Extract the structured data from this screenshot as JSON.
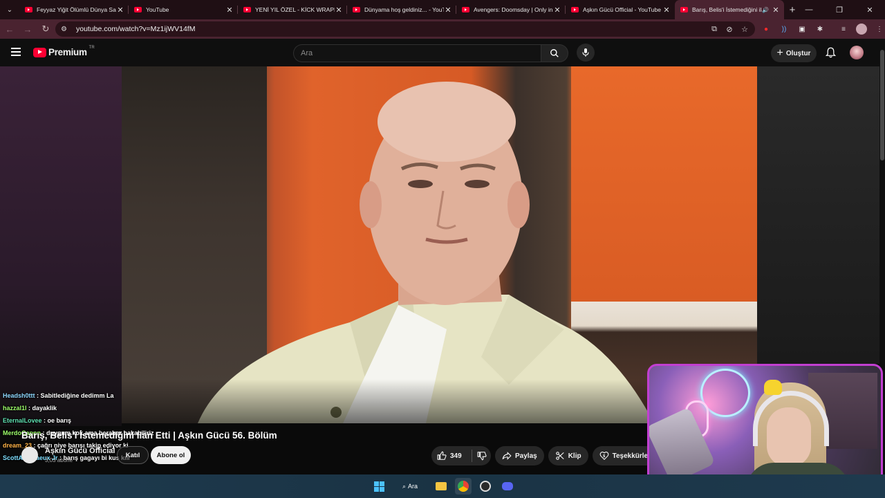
{
  "browser": {
    "tabs": [
      {
        "title": "Feyyaz Yiğit Ölümlü Dünya Sah",
        "active": false
      },
      {
        "title": "YouTube",
        "active": false
      },
      {
        "title": "YENİ YIL ÖZEL - KİCK WRAPPED",
        "active": false
      },
      {
        "title": "Dünyama hoş geldiniz... - YouT",
        "active": false
      },
      {
        "title": "Avengers: Doomsday | Only in",
        "active": false
      },
      {
        "title": "Aşkın Gücü Official - YouTube",
        "active": false
      },
      {
        "title": "Barış, Belis'i İstemediğini ila",
        "active": true
      }
    ],
    "new_tab_label": "+",
    "url": "youtube.com/watch?v=Mz1ijWV14fM"
  },
  "youtube": {
    "logo_word": "Premium",
    "country_code": "TR",
    "search_placeholder": "Ara",
    "create_label": "Oluştur"
  },
  "video": {
    "title": "Barış, Belis'i İstemediğini Ilan Etti | Aşkın Gücü 56. Bölüm",
    "channel_name": "Aşkın Gücü Official",
    "subscribers": "3,03 abone",
    "join_label": "Katıl",
    "subscribe_label": "Abone ol",
    "likes": "349",
    "share_label": "Paylaş",
    "clip_label": "Klip",
    "thanks_label": "Teşekkürler"
  },
  "chat": [
    {
      "user": "Headsh0ttt",
      "color": "#8fd9ff",
      "message": "Sabitlediğine dedimm La"
    },
    {
      "user": "hazzal1l",
      "color": "#9dff6a",
      "message": "dayaklik"
    },
    {
      "user": "EternalLovee",
      "color": "#5ee0b0",
      "message": "oe barış"
    },
    {
      "user": "MerdoCapnn",
      "color": "#9dff6a",
      "message": "duygum kok ama beraber bakabiliriz"
    },
    {
      "user": "dream_23",
      "color": "#ffb347",
      "message": "çağrı niye barışı takip ediyor ki"
    },
    {
      "user": "ScottArcanaeux Jr",
      "color": "#7fdfff",
      "message": "barış gagayı bi kus kıll"
    }
  ],
  "taskbar": {
    "search_label": "Ara"
  },
  "colors": {
    "youtube_red": "#ff0033",
    "tab_bar": "#1f0f14",
    "active_tab": "#4a2330",
    "webcam_border": "#c23fd1"
  }
}
